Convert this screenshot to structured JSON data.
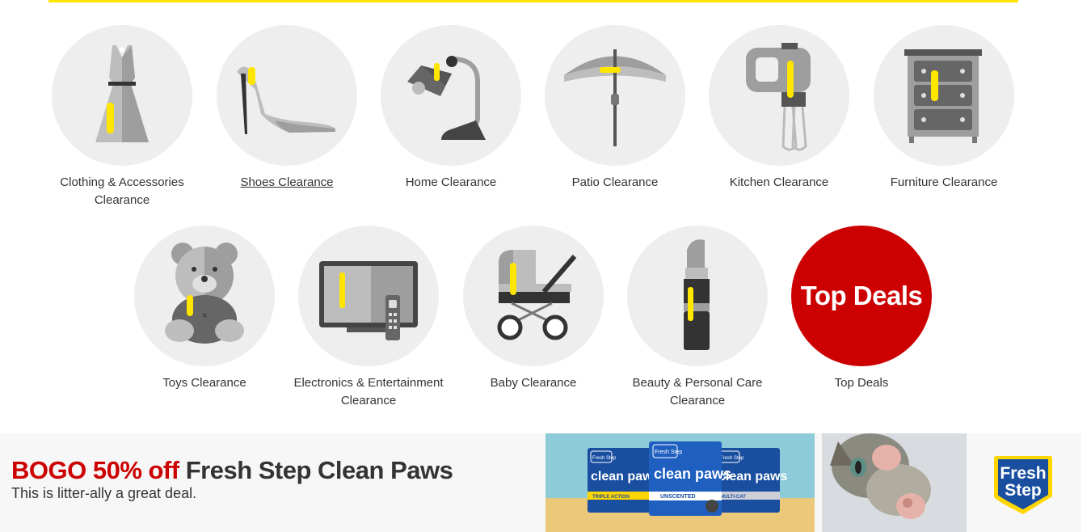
{
  "categories_row1": [
    {
      "label": "Clothing & Accessories Clearance",
      "icon": "dress-icon"
    },
    {
      "label": "Shoes Clearance",
      "icon": "high-heel-icon"
    },
    {
      "label": "Home Clearance",
      "icon": "desk-lamp-icon"
    },
    {
      "label": "Patio Clearance",
      "icon": "patio-umbrella-icon"
    },
    {
      "label": "Kitchen Clearance",
      "icon": "hand-mixer-icon"
    },
    {
      "label": "Furniture Clearance",
      "icon": "dresser-icon"
    }
  ],
  "categories_row2": [
    {
      "label": "Toys Clearance",
      "icon": "teddy-bear-icon"
    },
    {
      "label": "Electronics & Entertainment Clearance",
      "icon": "tv-remote-icon"
    },
    {
      "label": "Baby Clearance",
      "icon": "stroller-icon"
    },
    {
      "label": "Beauty & Personal Care Clearance",
      "icon": "lipstick-icon"
    },
    {
      "label": "Top Deals",
      "badge_text": "Top Deals"
    }
  ],
  "promo": {
    "title_highlight": "BOGO 50% off",
    "title_rest": "Fresh Step Clean Paws",
    "subtitle": "This is litter-ally a great deal.",
    "box_labels": [
      "clean paws",
      "clean paws",
      "clean paws"
    ],
    "box_variants": [
      "TRIPLE ACTION",
      "UNSCENTED",
      "MULTI-CAT"
    ],
    "box_brand": "Fresh Step",
    "logo_line1": "Fresh",
    "logo_line2": "Step"
  },
  "colors": {
    "accent_yellow": "#ffe600",
    "deal_red": "#cc0000",
    "circle_bg": "#eeeeee",
    "text": "#333333"
  }
}
